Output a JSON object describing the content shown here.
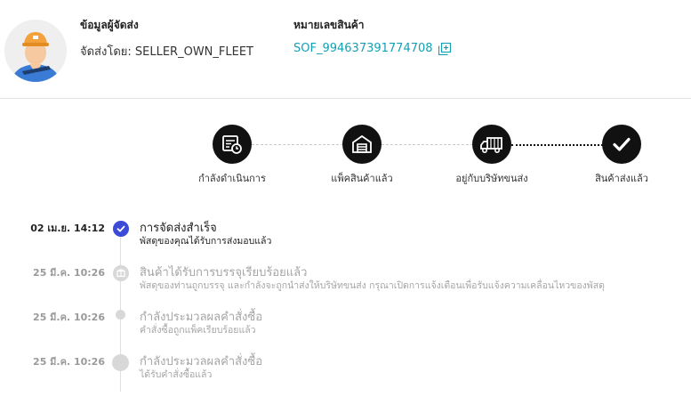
{
  "seller": {
    "title": "ข้อมูลผู้จัดส่ง",
    "shipped_by": "จัดส่งโดย: SELLER_OWN_FLEET"
  },
  "tracking": {
    "title": "หมายเลขสินค้า",
    "number": "SOF_994637391774708"
  },
  "steps": [
    {
      "label": "กำลังดำเนินการ",
      "icon": "document-clock-icon"
    },
    {
      "label": "แพ็คสินค้าแล้ว",
      "icon": "warehouse-box-icon"
    },
    {
      "label": "อยู่กับบริษัทขนส่ง",
      "icon": "delivery-truck-icon"
    },
    {
      "label": "สินค้าส่งแล้ว",
      "icon": "check-icon"
    }
  ],
  "events": [
    {
      "time": "02 เม.ย. 14:12",
      "title": "การจัดส่งสำเร็จ",
      "subtitle": "พัสดุของคุณได้รับการส่งมอบแล้ว"
    },
    {
      "time": "25 มี.ค. 10:26",
      "title": "สินค้าได้รับการบรรจุเรียบร้อยแล้ว",
      "subtitle": "พัสดุของท่านถูกบรรจุ และกำลังจะถูกนำส่งให้บริษัทขนส่ง กรุณาเปิดการแจ้งเตือนเพื่อรับแจ้งความเคลื่อนไหวของพัสดุ"
    },
    {
      "time": "25 มี.ค. 10:26",
      "title": "กำลังประมวลผลคำสั่งซื้อ",
      "subtitle": "คำสั่งซื้อถูกแพ็คเรียบร้อยแล้ว"
    },
    {
      "time": "25 มี.ค. 10:26",
      "title": "กำลังประมวลผลคำสั่งซื้อ",
      "subtitle": "ได้รับคำสั่งซื้อแล้ว"
    }
  ],
  "colors": {
    "accent_link": "#14a0b3",
    "active_dot": "#3b4bd8",
    "step_circle": "#111111",
    "inactive_text": "#a5a5a5"
  }
}
